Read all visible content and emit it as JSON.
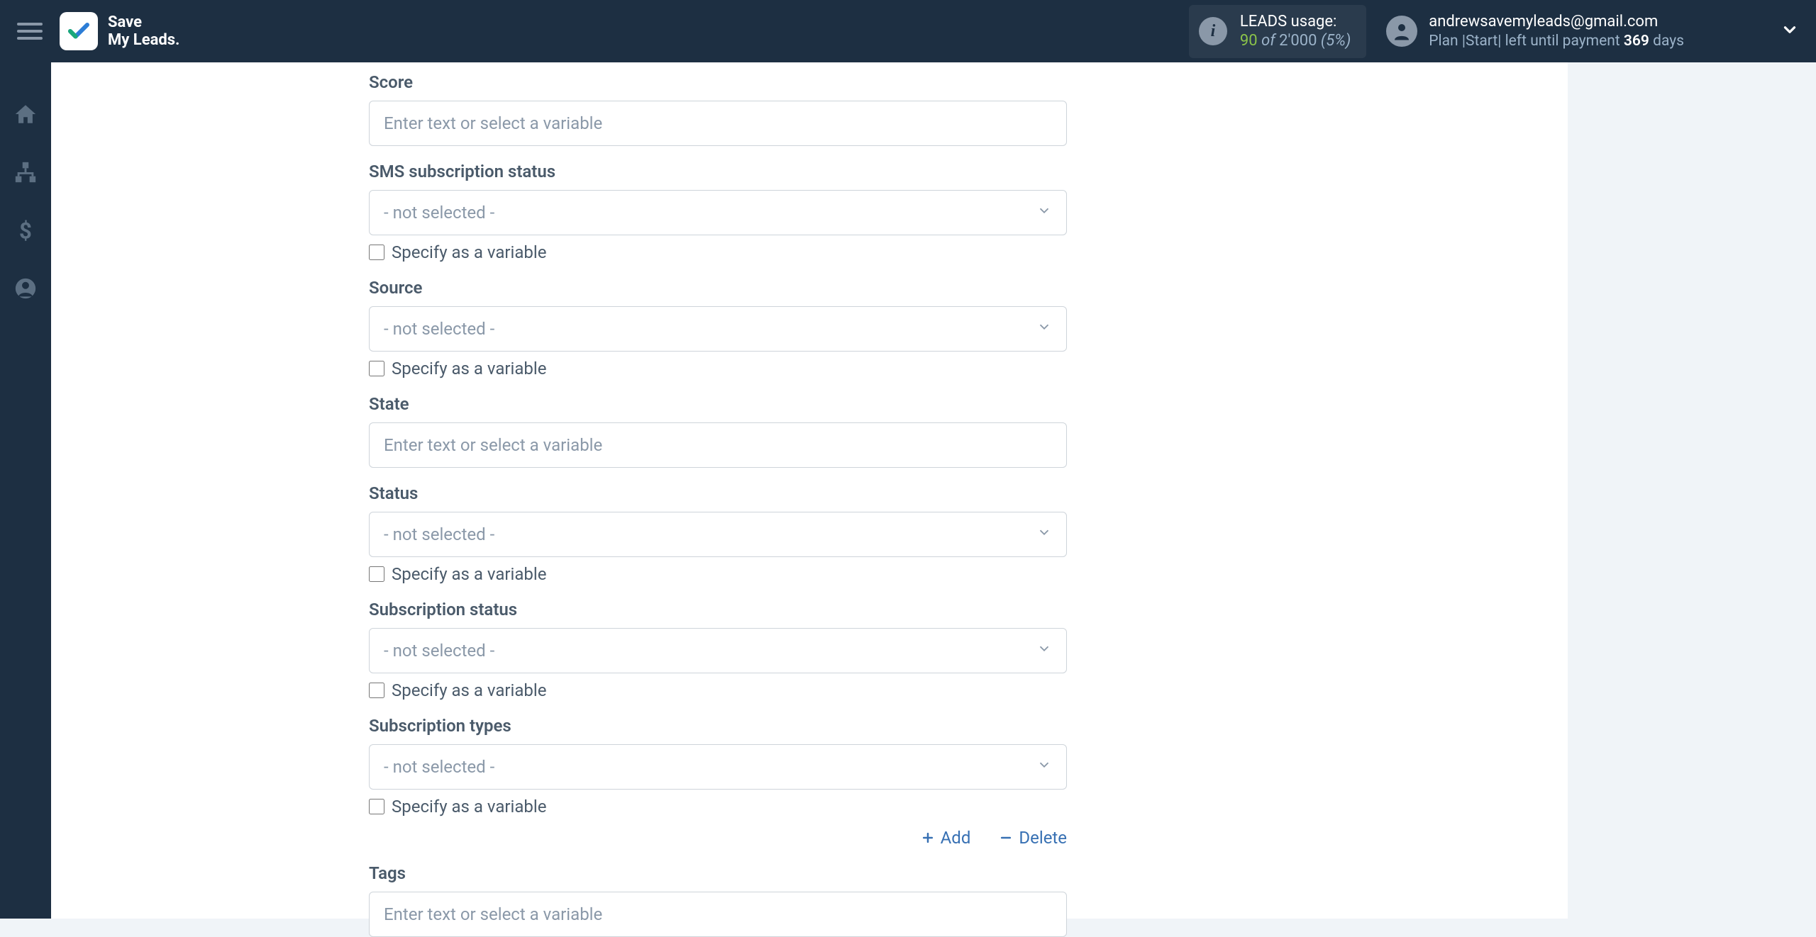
{
  "header": {
    "logo_line1": "Save",
    "logo_line2": "My Leads.",
    "leads_usage_label": "LEADS usage:",
    "leads_used": "90",
    "leads_of": "of",
    "leads_total": "2'000",
    "leads_pct": "(5%)",
    "account_email": "andrewsavemyleads@gmail.com",
    "plan_prefix": "Plan |Start| left until payment ",
    "plan_days": "369",
    "plan_suffix": " days"
  },
  "form": {
    "score_label": "Score",
    "text_placeholder": "Enter text or select a variable",
    "not_selected": "- not selected -",
    "specify_variable": "Specify as a variable",
    "sms_label": "SMS subscription status",
    "source_label": "Source",
    "state_label": "State",
    "status_label": "Status",
    "subscription_status_label": "Subscription status",
    "subscription_types_label": "Subscription types",
    "tags_label": "Tags",
    "add_label": "Add",
    "delete_label": "Delete"
  }
}
